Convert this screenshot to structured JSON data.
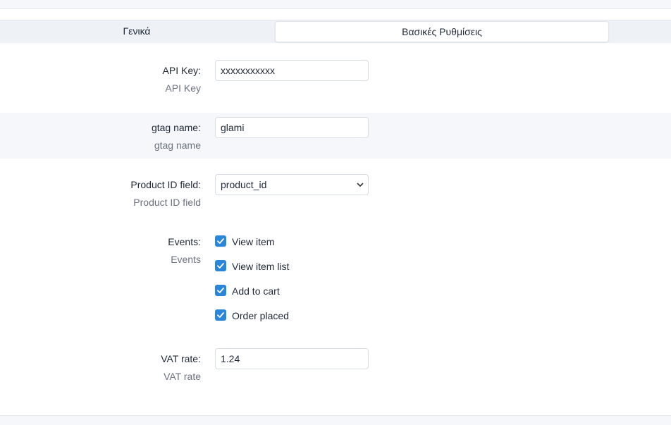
{
  "tabs": {
    "general": "Γενικά",
    "basic_settings": "Βασικές Ρυθμίσεις"
  },
  "fields": {
    "api_key": {
      "label": "API Key:",
      "help": "API Key",
      "value": "xxxxxxxxxxx"
    },
    "gtag_name": {
      "label": "gtag name:",
      "help": "gtag name",
      "value": "glami"
    },
    "product_id": {
      "label": "Product ID field:",
      "help": "Product ID field",
      "selected": "product_id"
    },
    "events": {
      "label": "Events:",
      "help": "Events",
      "items": [
        {
          "label": "View item",
          "checked": true
        },
        {
          "label": "View item list",
          "checked": true
        },
        {
          "label": "Add to cart",
          "checked": true
        },
        {
          "label": "Order placed",
          "checked": true
        }
      ]
    },
    "vat_rate": {
      "label": "VAT rate:",
      "help": "VAT rate",
      "value": "1.24"
    }
  },
  "colors": {
    "accent": "#2a86d9",
    "alt_row": "#f5f7fa"
  }
}
